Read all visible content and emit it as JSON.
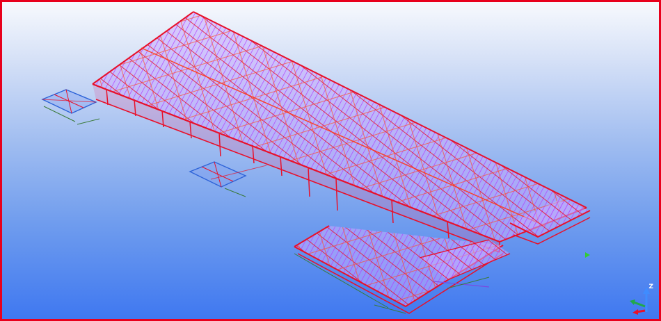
{
  "viewport": {
    "border_color": "#e8001c",
    "background_top": "#f7f9fd",
    "background_bottom": "#3f78f0"
  },
  "model": {
    "frame_color": "#e8102a",
    "purlin_color": "#b040ff",
    "plate_color": "#2d63d8",
    "ground_line_color": "#3a7a3a",
    "node_marker_color": "#33cc33"
  },
  "view_triad": {
    "z_label": "Z",
    "z_icon": "arrow-up-blue",
    "x_icon": "arrow-green",
    "y_icon": "arrow-red"
  }
}
